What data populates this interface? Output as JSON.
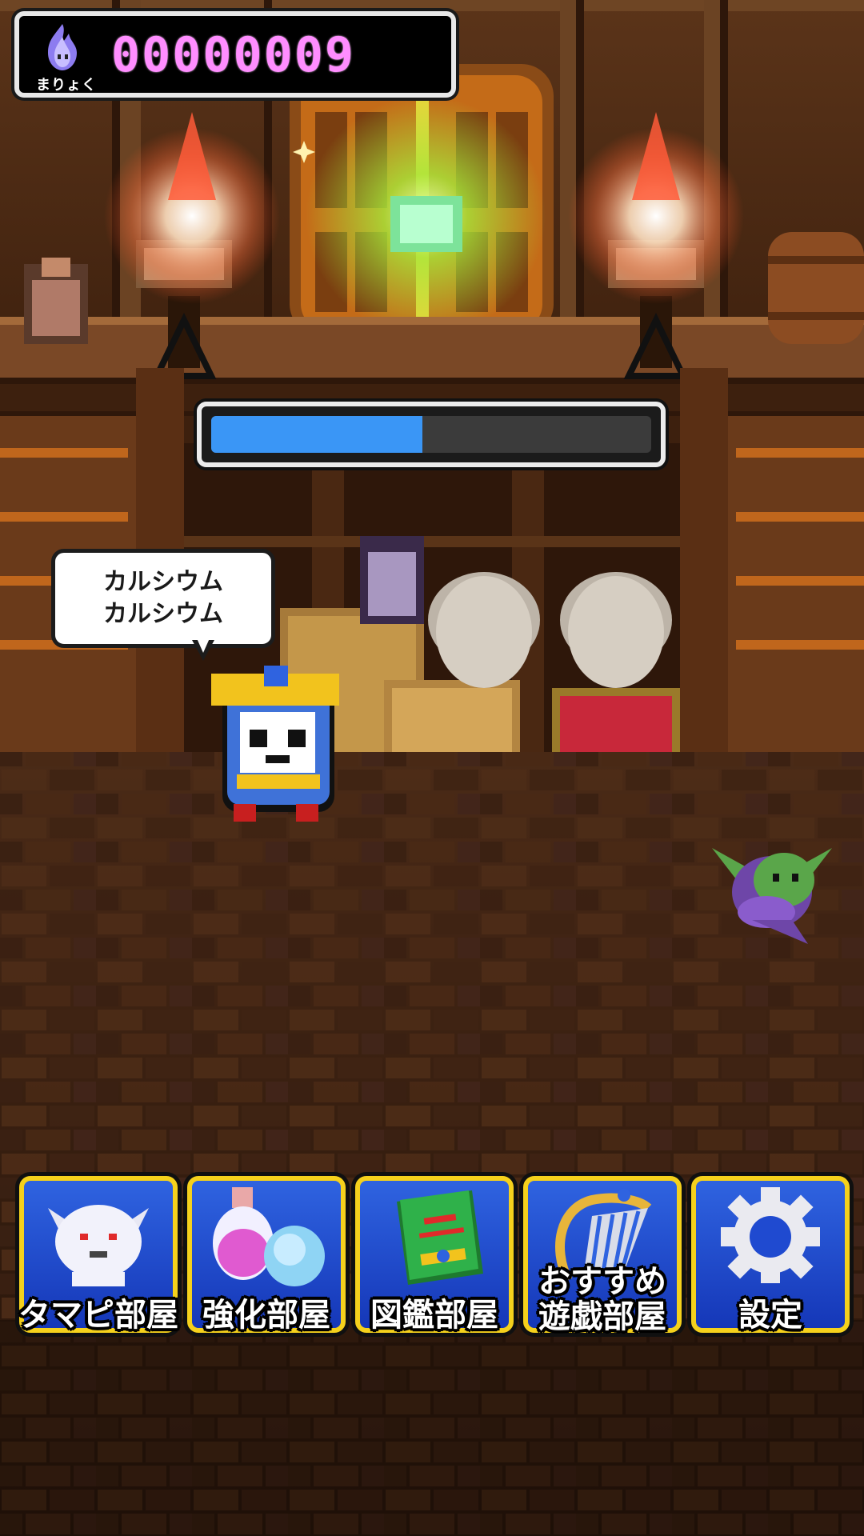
{
  "hud": {
    "mana_label": "まりょく",
    "mana_value": "00000009",
    "progress_fraction": 0.48
  },
  "speech": {
    "line1": "カルシウム",
    "line2": "カルシウム"
  },
  "menu": {
    "buttons": [
      {
        "label": "タマピ部屋",
        "icon": "ghost-icon"
      },
      {
        "label": "強化部屋",
        "icon": "potion-icon"
      },
      {
        "label": "図鑑部屋",
        "icon": "book-icon"
      },
      {
        "label_line1": "おすすめ",
        "label_line2": "遊戯部屋",
        "icon": "harp-icon"
      },
      {
        "label": "設定",
        "icon": "gear-icon"
      }
    ]
  },
  "colors": {
    "mana_digits": "#ff8dff",
    "progress_fill": "#3a96f6",
    "button_bg": "#1f4ad0",
    "button_border": "#f5d11c"
  }
}
